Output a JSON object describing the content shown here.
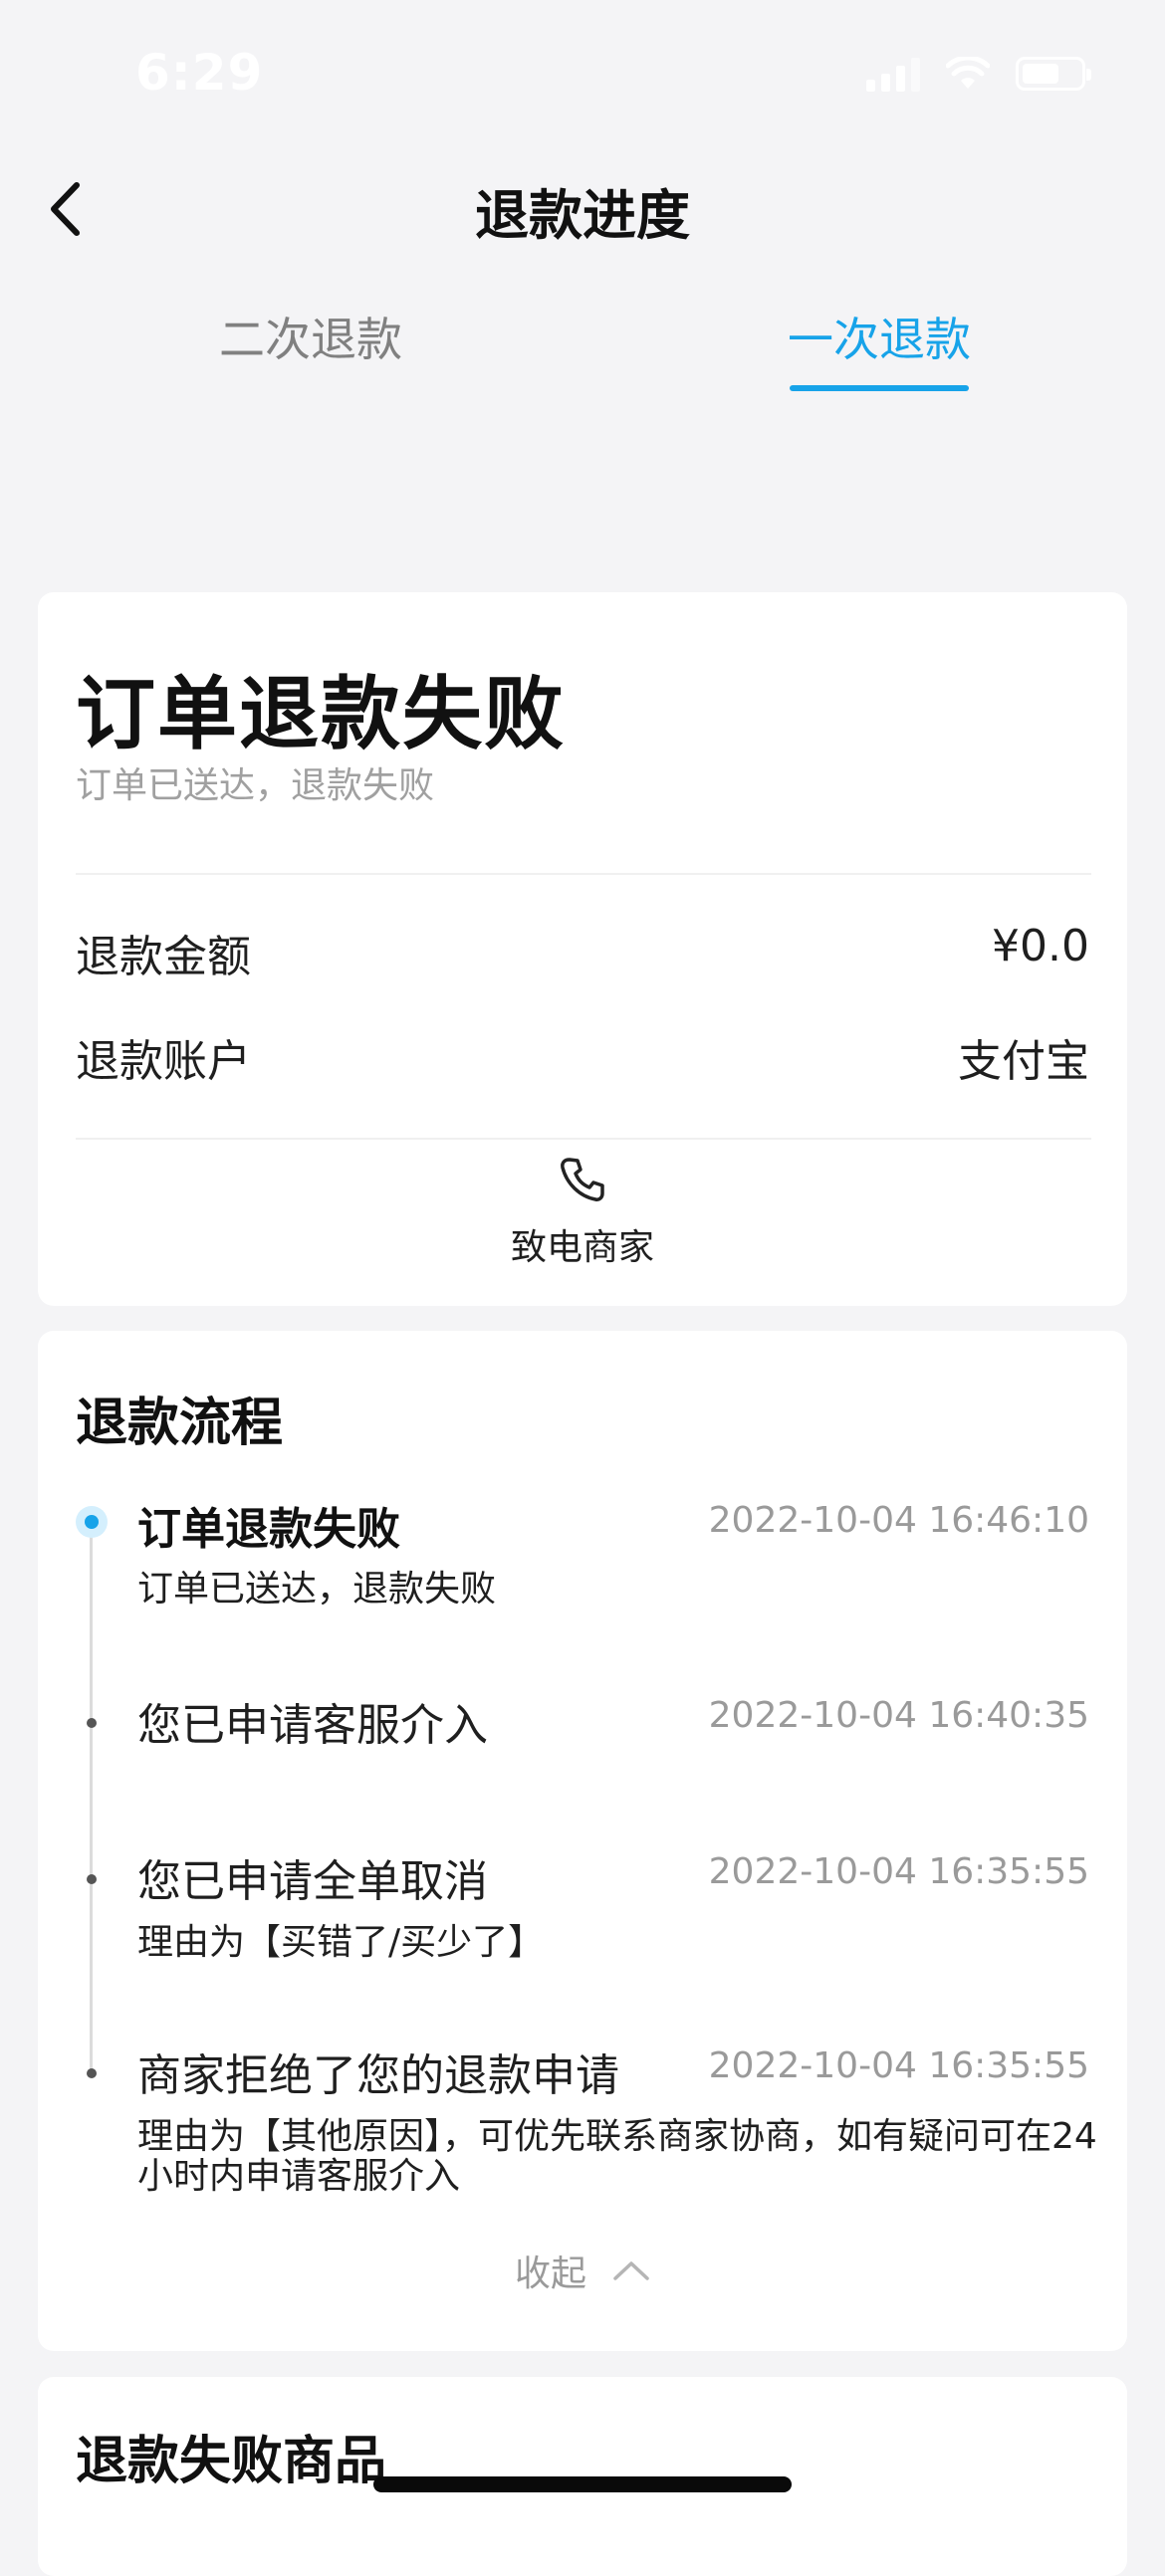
{
  "status_bar": {
    "time": "6:29"
  },
  "header": {
    "title": "退款进度"
  },
  "tabs": [
    {
      "label": "二次退款",
      "active": false
    },
    {
      "label": "一次退款",
      "active": true
    }
  ],
  "summary": {
    "status_title": "订单退款失败",
    "status_subtitle": "订单已送达，退款失败",
    "rows": [
      {
        "label": "退款金额",
        "value": "¥0.0"
      },
      {
        "label": "退款账户",
        "value": "支付宝"
      }
    ],
    "call_label": "致电商家"
  },
  "process": {
    "title": "退款流程",
    "events": [
      {
        "title": "订单退款失败",
        "time": "2022-10-04 16:46:10",
        "desc": "订单已送达，退款失败"
      },
      {
        "title": "您已申请客服介入",
        "time": "2022-10-04 16:40:35",
        "desc": ""
      },
      {
        "title": "您已申请全单取消",
        "time": "2022-10-04 16:35:55",
        "desc": "理由为【买错了/买少了】"
      },
      {
        "title": "商家拒绝了您的退款申请",
        "time": "2022-10-04 16:35:55",
        "desc": "理由为【其他原因】，可优先联系商家协商，如有疑问可在24小时内申请客服介入"
      }
    ],
    "collapse_label": "收起"
  },
  "failed_goods": {
    "title": "退款失败商品"
  },
  "colors": {
    "accent": "#17a3e9",
    "background": "#f4f4f6"
  }
}
